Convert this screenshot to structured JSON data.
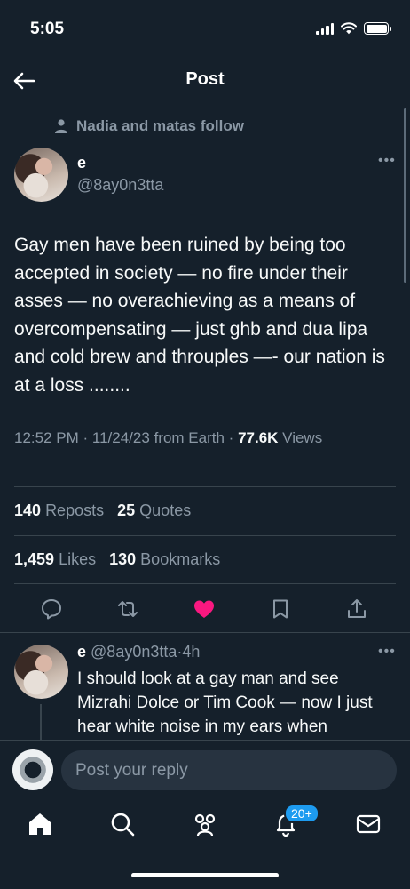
{
  "status_bar": {
    "time": "5:05"
  },
  "header": {
    "title": "Post"
  },
  "social_context": {
    "text": "Nadia and matas follow"
  },
  "tweet": {
    "author_name": "e",
    "author_handle": "@8ay0n3tta",
    "text": "Gay men have been ruined by being too accepted in society — no fire under their asses — no overachieving as a means of overcompensating — just ghb and dua lipa and cold brew and throuples —- our nation is at a loss ........",
    "time": "12:52 PM",
    "date": "11/24/23",
    "source": "from Earth",
    "views_count": "77.6K",
    "views_label": "Views",
    "separator": "·"
  },
  "stats": {
    "reposts": {
      "count": "140",
      "label": "Reposts"
    },
    "quotes": {
      "count": "25",
      "label": "Quotes"
    },
    "likes": {
      "count": "1,459",
      "label": "Likes"
    },
    "bookmarks": {
      "count": "130",
      "label": "Bookmarks"
    }
  },
  "actions": [
    "reply-icon",
    "repost-icon",
    "like-icon-filled",
    "bookmark-icon",
    "share-icon"
  ],
  "colors": {
    "background": "#15202b",
    "like": "#f91880",
    "accent": "#1d9bf0",
    "muted": "#8b98a5",
    "divider": "#38444d"
  },
  "reply": {
    "author_name": "e",
    "author_handle": "@8ay0n3tta",
    "separator": "·",
    "age": "4h",
    "text": "I should look at a gay man and see Mizrahi Dolce or Tim Cook — now I just hear white noise in my ears when"
  },
  "composer": {
    "placeholder": "Post your reply"
  },
  "tabbar": {
    "items": [
      "home-icon",
      "search-icon",
      "communities-icon",
      "notifications-icon",
      "messages-icon"
    ],
    "notifications_badge": "20+"
  }
}
